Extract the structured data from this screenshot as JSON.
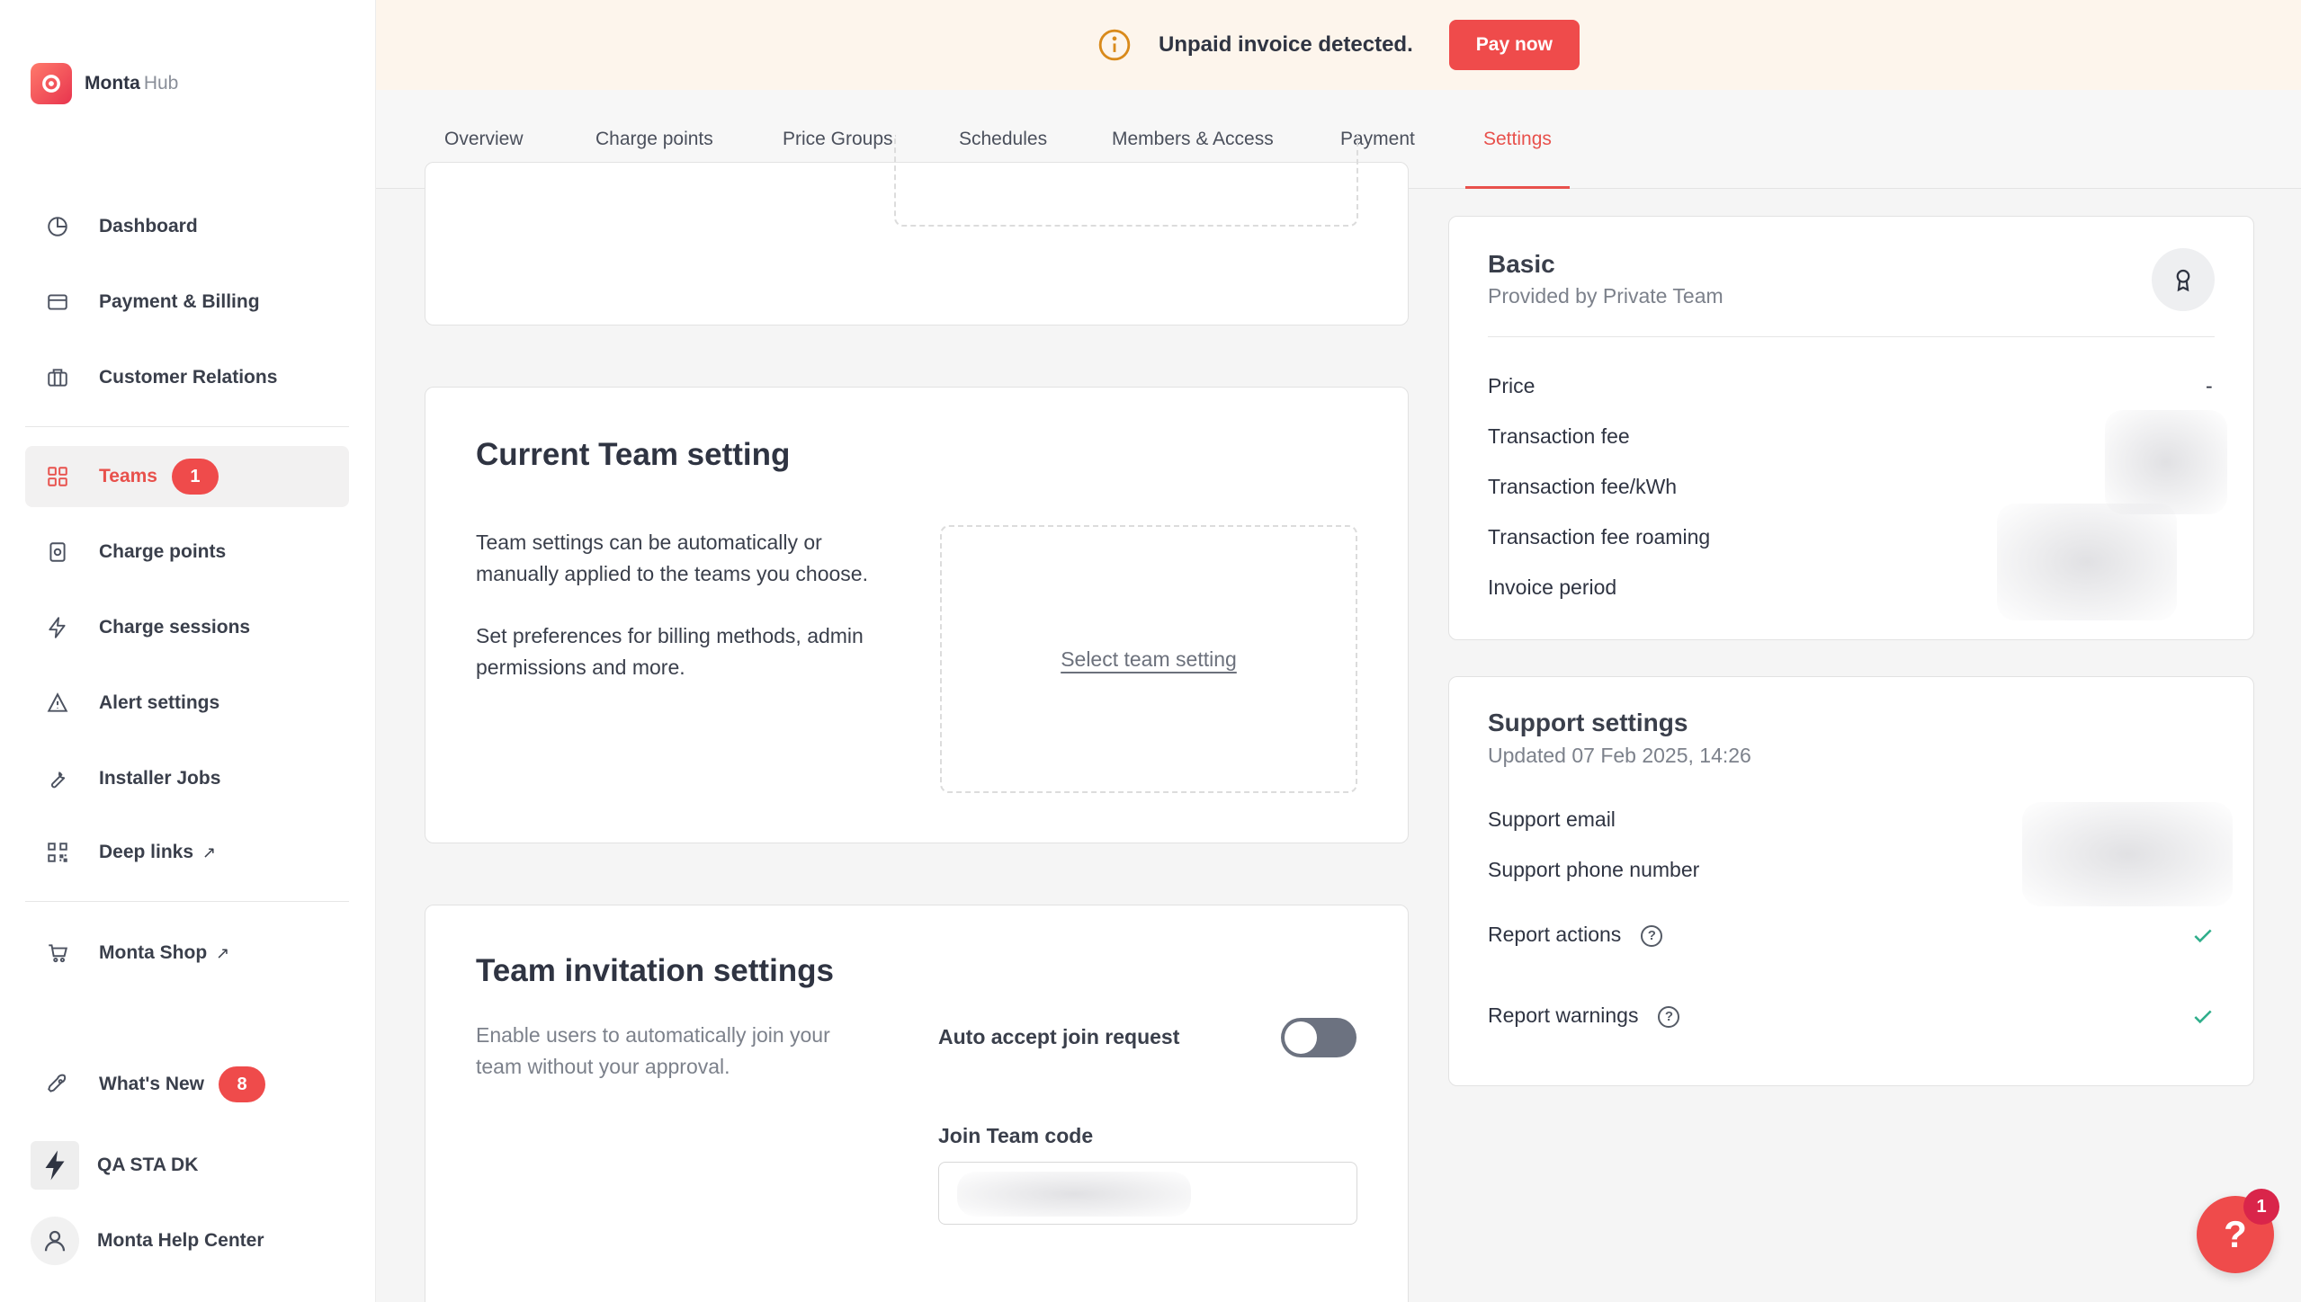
{
  "brand": {
    "name": "Monta",
    "suffix": "Hub"
  },
  "sidebar": {
    "items": [
      {
        "label": "Dashboard",
        "icon": "pie-chart-icon"
      },
      {
        "label": "Payment & Billing",
        "icon": "credit-card-icon"
      },
      {
        "label": "Customer Relations",
        "icon": "briefcase-icon"
      },
      {
        "label": "Teams",
        "icon": "grid-icon",
        "badge": "1",
        "active": true
      },
      {
        "label": "Charge points",
        "icon": "charger-icon"
      },
      {
        "label": "Charge sessions",
        "icon": "bolt-icon"
      },
      {
        "label": "Alert settings",
        "icon": "alert-bell-icon"
      },
      {
        "label": "Installer Jobs",
        "icon": "wrench-icon"
      },
      {
        "label": "Deep links",
        "icon": "qr-code-icon",
        "external": "↗"
      }
    ],
    "shop": {
      "label": "Monta Shop",
      "external": "↗"
    },
    "whats_new": {
      "label": "What's New",
      "badge": "8"
    },
    "account": {
      "label": "QA STA DK"
    },
    "help_center": {
      "label": "Monta Help Center"
    }
  },
  "banner": {
    "message": "Unpaid invoice detected.",
    "button": "Pay now"
  },
  "tabs": [
    "Overview",
    "Charge points",
    "Price Groups",
    "Schedules",
    "Members & Access",
    "Payment",
    "Settings"
  ],
  "current_team": {
    "title": "Current Team setting",
    "desc1": "Team settings can be automatically or manually applied to the teams you choose.",
    "desc2": "Set preferences for billing methods, admin permissions and more.",
    "select_link": "Select team setting"
  },
  "invitation": {
    "title": "Team invitation settings",
    "desc": "Enable users to automatically join your team without your approval.",
    "auto_accept_label": "Auto accept join request",
    "join_code_label": "Join Team code"
  },
  "plan": {
    "title": "Basic",
    "provider": "Provided by Private Team",
    "rows": [
      "Price",
      "Transaction fee",
      "Transaction fee/kWh",
      "Transaction fee roaming",
      "Invoice period"
    ],
    "price_value": "-"
  },
  "support": {
    "title": "Support settings",
    "updated": "Updated 07 Feb 2025, 14:26",
    "email_label": "Support email",
    "phone_label": "Support phone number",
    "report_actions": "Report actions",
    "report_warnings": "Report warnings"
  },
  "help_widget": {
    "glyph": "?",
    "badge": "1"
  },
  "colors": {
    "accent": "#ef4b4b",
    "banner_bg": "#fdf5ec",
    "check": "#2fae8b"
  }
}
